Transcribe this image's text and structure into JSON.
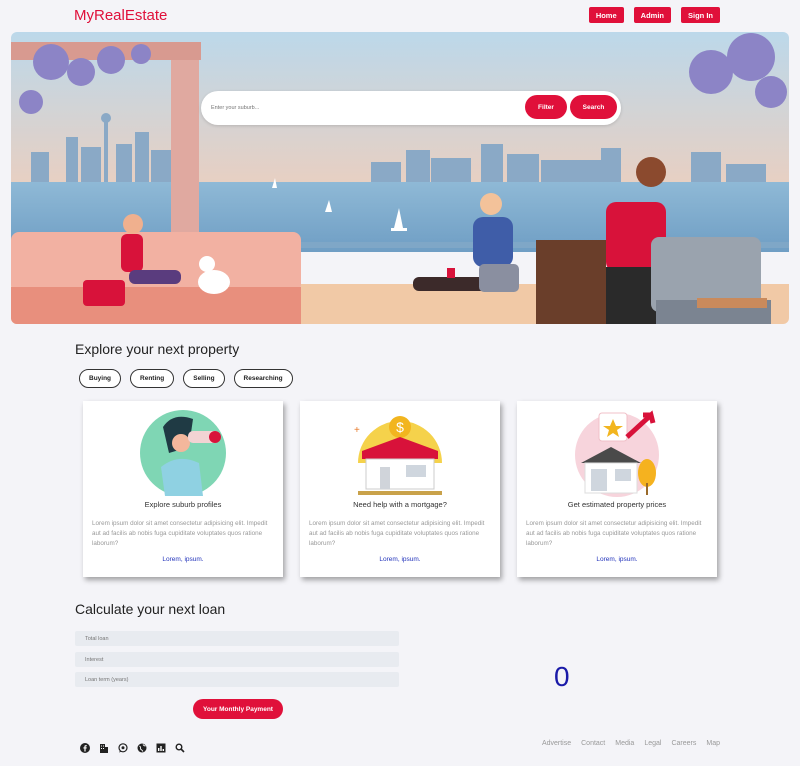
{
  "header": {
    "logo": "MyRealEstate",
    "nav": {
      "home": "Home",
      "admin": "Admin",
      "signin": "Sign In"
    }
  },
  "search": {
    "placeholder": "Enter your suburb...",
    "filter_label": "Filter",
    "search_label": "Search"
  },
  "explore": {
    "title": "Explore your next property",
    "chips": [
      "Buying",
      "Renting",
      "Selling",
      "Researching"
    ]
  },
  "cards": [
    {
      "title": "Explore suburb profiles",
      "text": "Lorem ipsum dolor sit amet consectetur adipisicing elit. Impedit aut ad facilis ab nobis fuga cupiditate voluptates quos ratione laborum?",
      "link": "Lorem, ipsum."
    },
    {
      "title": "Need help with a mortgage?",
      "text": "Lorem ipsum dolor sit amet consectetur adipisicing elit. Impedit aut ad facilis ab nobis fuga cupiditate voluptates quos ratione laborum?",
      "link": "Lorem, ipsum."
    },
    {
      "title": "Get estimated property prices",
      "text": "Lorem ipsum dolor sit amet consectetur adipisicing elit. Impedit aut ad facilis ab nobis fuga cupiditate voluptates quos ratione laborum?",
      "link": "Lorem, ipsum."
    }
  ],
  "loan": {
    "title": "Calculate your next loan",
    "fields": {
      "total": "Total loan",
      "interest": "Interest",
      "term": "Loan term (years)"
    },
    "button": "Your Monthly Payment",
    "result": "0"
  },
  "footer": {
    "icons": [
      "facebook-icon",
      "building-icon",
      "whatsapp-icon",
      "globe-icon",
      "chart-icon",
      "search-icon"
    ],
    "links": [
      "Advertise",
      "Contact",
      "Media",
      "Legal",
      "Careers",
      "Map"
    ]
  },
  "colors": {
    "accent": "#e0103a",
    "link": "#2233bb",
    "result": "#1a1aa8",
    "background": "#f4f4f8"
  }
}
